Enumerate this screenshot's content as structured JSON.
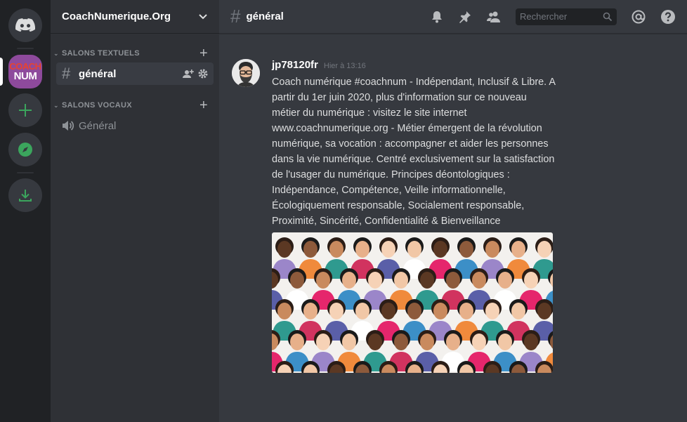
{
  "server": {
    "name": "CoachNumerique.Org",
    "icon_top": "COACH",
    "icon_bottom": "NUM"
  },
  "categories": [
    {
      "label": "SALONS TEXTUELS"
    },
    {
      "label": "SALONS VOCAUX"
    }
  ],
  "channels": {
    "text": [
      {
        "name": "général"
      }
    ],
    "voice": [
      {
        "name": "Général"
      }
    ]
  },
  "header": {
    "channel": "général",
    "search_placeholder": "Rechercher"
  },
  "message": {
    "author": "jp78120fr",
    "timestamp": "Hier à 13:16",
    "content": "Coach numérique #coachnum - Indépendant, Inclusif & Libre. A partir du 1er juin 2020, plus d'information sur ce nouveau métier du numérique : visitez le site internet www.coachnumerique.org -  Métier émergent de la révolution numérique, sa vocation : accompagner et aider les personnes dans la vie numérique. Centré exclusivement sur la satisfaction de l'usager du numérique. Principes déontologiques : Indépendance, Compétence, Veille informationnelle, Écologiquement responsable, Socialement responsable, Proximité, Sincérité, Confidentialité & Bienveillance"
  },
  "colors": {
    "rail": "#202225",
    "sidebar": "#2f3136",
    "main": "#36393f",
    "green": "#3ba55d",
    "server_purple": "#8e4a9c",
    "coach_red": "#e8432f"
  },
  "icons": [
    "discord-logo-icon",
    "plus-icon",
    "compass-icon",
    "download-icon",
    "hash-icon",
    "add-member-icon",
    "gear-icon",
    "speaker-icon",
    "bell-icon",
    "pin-icon",
    "members-icon",
    "search-icon",
    "mention-icon",
    "help-icon",
    "chevron-down-icon"
  ]
}
